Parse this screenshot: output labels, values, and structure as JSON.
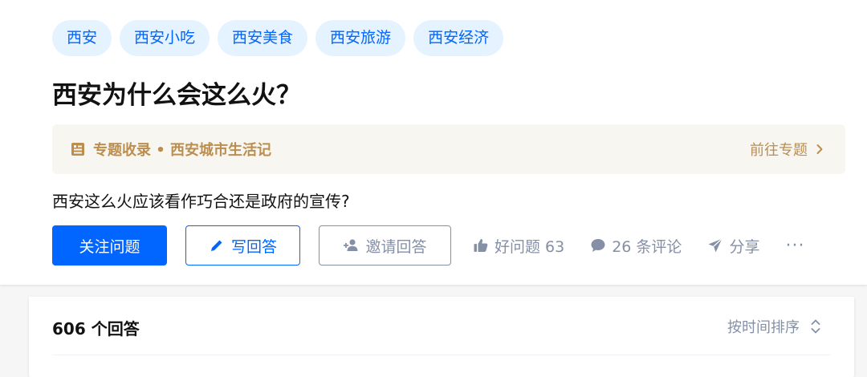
{
  "topics": [
    {
      "label": "西安"
    },
    {
      "label": "西安小吃"
    },
    {
      "label": "西安美食"
    },
    {
      "label": "西安旅游"
    },
    {
      "label": "西安经济"
    }
  ],
  "question": {
    "title": "西安为什么会这么火？",
    "detail": "西安这么火应该看作巧合还是政府的宣传?"
  },
  "collection": {
    "label": "专题收录 • 西安城市生活记",
    "link_label": "前往专题"
  },
  "actions": {
    "follow": "关注问题",
    "write_answer": "写回答",
    "invite": "邀请回答",
    "good_question": "好问题 63",
    "comments": "26 条评论",
    "share": "分享",
    "more": "···"
  },
  "answers": {
    "count_label": "606 个回答",
    "sort_label": "按时间排序"
  },
  "colors": {
    "brand_blue": "#0066ff",
    "tag_bg": "#e5f2ff",
    "gold": "#bb8e4f",
    "gray": "#8590a6"
  },
  "icons": {
    "collection": "document-list-icon",
    "chevron": "chevron-right-icon",
    "pencil": "pencil-icon",
    "invite": "add-user-icon",
    "like": "thumbs-up-icon",
    "comment": "comment-bubble-icon",
    "share": "paper-plane-icon",
    "sort": "sort-updown-icon"
  }
}
